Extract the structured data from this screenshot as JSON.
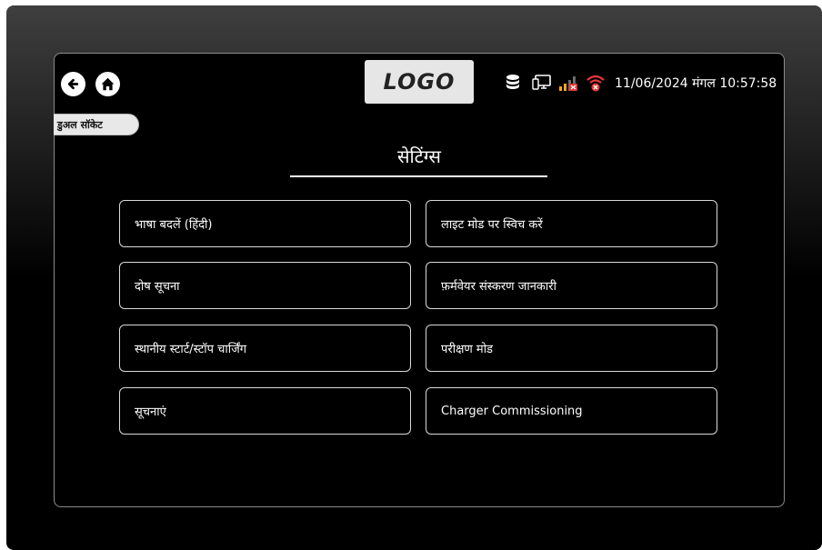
{
  "header": {
    "logo_text": "LOGO",
    "datetime": "11/06/2024 मंगल 10:57:58",
    "mode_tab": "डुअल सॉकेट"
  },
  "icons": {
    "back": "back-arrow-icon",
    "home": "home-icon",
    "database": "database-icon",
    "network": "network-icon",
    "signal": "signal-icon",
    "wifi": "wifi-error-icon"
  },
  "page": {
    "title": "सेटिंग्स"
  },
  "options": [
    {
      "label": "भाषा बदलें (हिंदी)"
    },
    {
      "label": "लाइट मोड पर स्विच करें"
    },
    {
      "label": "दोष सूचना"
    },
    {
      "label": "फ़र्मवेयर संस्करण जानकारी"
    },
    {
      "label": "स्थानीय स्टार्ट/स्टॉप चार्जिंग"
    },
    {
      "label": "परीक्षण मोड"
    },
    {
      "label": "सूचनाएं"
    },
    {
      "label": "Charger Commissioning"
    }
  ],
  "colors": {
    "background": "#000000",
    "border": "#d9d9d9",
    "error": "#e53935",
    "signal": "#f5a623"
  }
}
